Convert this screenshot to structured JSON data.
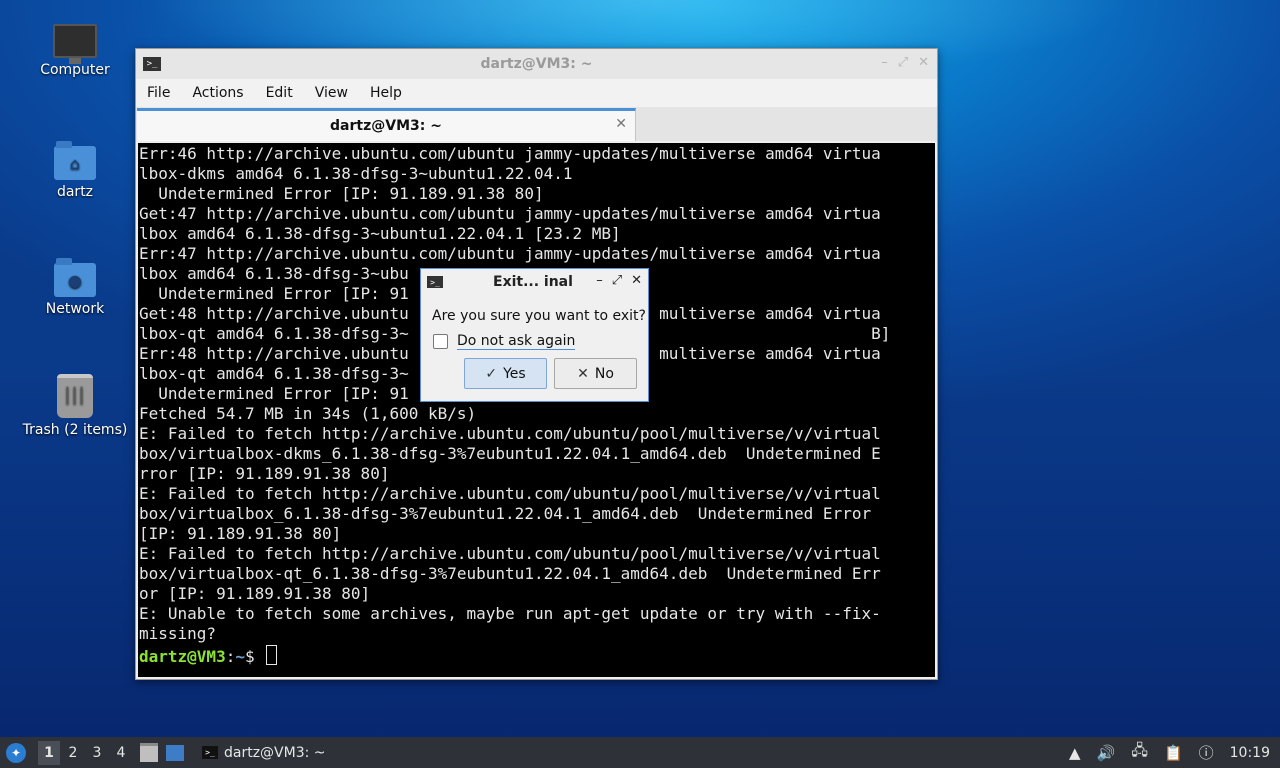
{
  "desktop": {
    "icons": [
      {
        "label": "Computer"
      },
      {
        "label": "dartz"
      },
      {
        "label": "Network"
      },
      {
        "label": "Trash (2 items)"
      }
    ]
  },
  "window": {
    "title": "dartz@VM3: ~",
    "menu": [
      "File",
      "Actions",
      "Edit",
      "View",
      "Help"
    ],
    "tab_title": "dartz@VM3: ~",
    "terminal_lines": [
      "Err:46 http://archive.ubuntu.com/ubuntu jammy-updates/multiverse amd64 virtua",
      "lbox-dkms amd64 6.1.38-dfsg-3~ubuntu1.22.04.1",
      "  Undetermined Error [IP: 91.189.91.38 80]",
      "Get:47 http://archive.ubuntu.com/ubuntu jammy-updates/multiverse amd64 virtua",
      "lbox amd64 6.1.38-dfsg-3~ubuntu1.22.04.1 [23.2 MB]",
      "Err:47 http://archive.ubuntu.com/ubuntu jammy-updates/multiverse amd64 virtua",
      "lbox amd64 6.1.38-dfsg-3~ubu",
      "  Undetermined Error [IP: 91",
      "Get:48 http://archive.ubuntu                          multiverse amd64 virtua",
      "lbox-qt amd64 6.1.38-dfsg-3~                                                B]",
      "Err:48 http://archive.ubuntu                          multiverse amd64 virtua",
      "lbox-qt amd64 6.1.38-dfsg-3~",
      "  Undetermined Error [IP: 91",
      "Fetched 54.7 MB in 34s (1,600 kB/s)",
      "E: Failed to fetch http://archive.ubuntu.com/ubuntu/pool/multiverse/v/virtual",
      "box/virtualbox-dkms_6.1.38-dfsg-3%7eubuntu1.22.04.1_amd64.deb  Undetermined E",
      "rror [IP: 91.189.91.38 80]",
      "E: Failed to fetch http://archive.ubuntu.com/ubuntu/pool/multiverse/v/virtual",
      "box/virtualbox_6.1.38-dfsg-3%7eubuntu1.22.04.1_amd64.deb  Undetermined Error",
      "[IP: 91.189.91.38 80]",
      "E: Failed to fetch http://archive.ubuntu.com/ubuntu/pool/multiverse/v/virtual",
      "box/virtualbox-qt_6.1.38-dfsg-3%7eubuntu1.22.04.1_amd64.deb  Undetermined Err",
      "or [IP: 91.189.91.38 80]",
      "E: Unable to fetch some archives, maybe run apt-get update or try with --fix-",
      "missing?"
    ],
    "prompt": {
      "user": "dartz@VM3",
      "sep": ":",
      "path": "~",
      "symbol": "$ "
    }
  },
  "dialog": {
    "title": "Exit... inal",
    "message": "Are you sure you want to exit?",
    "checkbox_label": "Do not ask again",
    "checkbox_checked": false,
    "yes_label": "Yes",
    "no_label": "No"
  },
  "taskbar": {
    "workspaces": [
      "1",
      "2",
      "3",
      "4"
    ],
    "active_workspace": "1",
    "task_label": "dartz@VM3: ~",
    "clock": "10:19"
  }
}
